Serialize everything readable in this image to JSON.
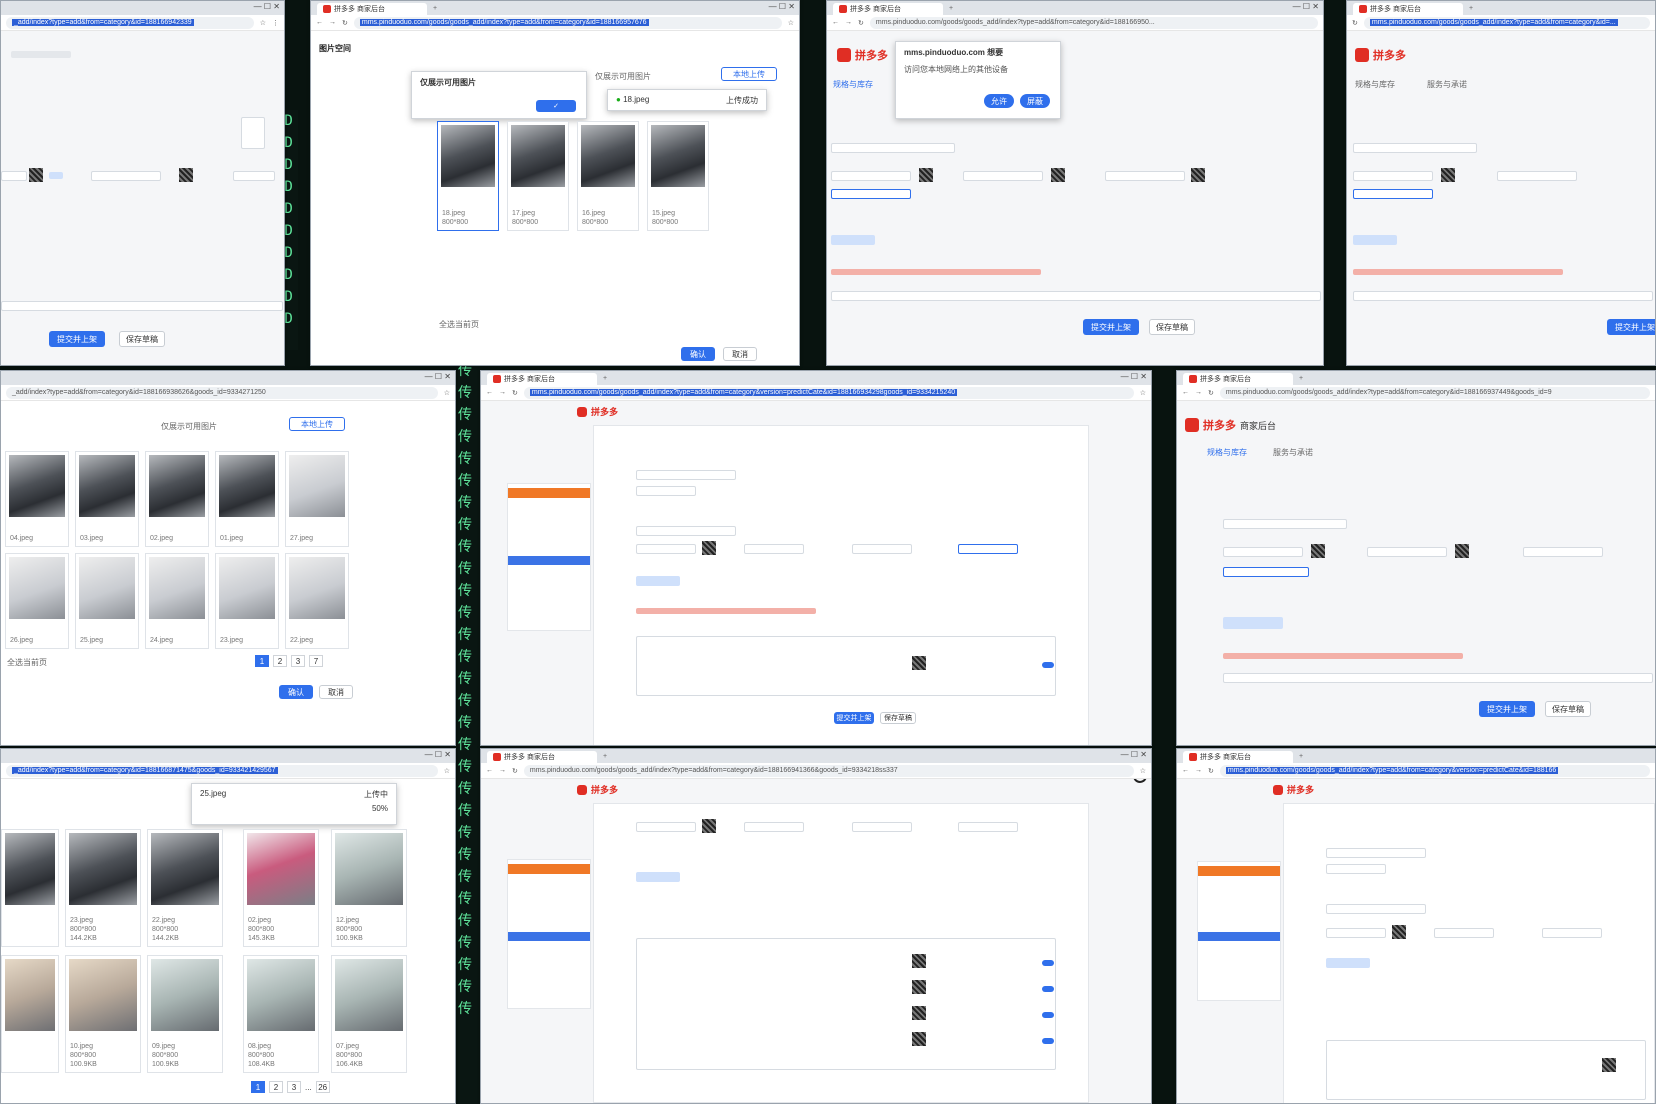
{
  "site": {
    "tab_title": "拼多多 商家后台",
    "domain": "mms.pinduoduo.com",
    "logo_text": "拼多多",
    "logo_sub": "商家后台"
  },
  "urls": {
    "w1": "_add/index?type=add&from=category&id=188166942339",
    "w2": "mms.pinduoduo.com/goods/goods_add/index?type=add&from=category&id=188166957676",
    "w3": "mms.pinduoduo.com/goods/goods_add/index?type=add&from=category&id=188166950...",
    "w4": "mms.pinduoduo.com/goods/goods_add/index?type=add&from=category&id=...",
    "w5": "_add/index?type=add&from=category&id=188166938626&goods_id=9334271250",
    "w6": "mms.pinduoduo.com/goods/goods_add/index?type=add&from=category&version=predictCate&id=188166934298goods_id=9334215240",
    "w7": "mms.pinduoduo.com/goods/goods_add/index?type=add&from=category&id=188166937449&goods_id=9",
    "w8": "_add/index?type=add&from=category&id=188166871475&goods_id=933421429567",
    "w9": "mms.pinduoduo.com/goods/goods_add/index?type=add&from=category&id=188166941366&goods_id=9334218ss337",
    "w10": "mms.pinduoduo.com/goods/goods_add/index?type=add&from=category&version=predictCate&id=188166"
  },
  "buttons": {
    "submit": "提交并上架",
    "save_draft": "保存草稿",
    "confirm": "确认",
    "cancel": "取消",
    "local_upload": "本地上传",
    "allow": "允许",
    "block": "屏蔽"
  },
  "nav": {
    "spec_stock": "规格与库存",
    "service": "服务与承诺"
  },
  "image_space": {
    "title": "图片空间",
    "only_usable": "仅展示可用图片",
    "tip_title": "仅展示可用图片",
    "select_all": "全选当前页",
    "uploading": "上传中",
    "upload_done": "上传成功"
  },
  "permission": {
    "site": "mms.pinduoduo.com 想要",
    "request": "访问您本地网络上的其他设备"
  },
  "thumbs_w2": [
    {
      "name": "18.jpeg",
      "size": "800*800"
    },
    {
      "name": "17.jpeg",
      "size": "800*800"
    },
    {
      "name": "16.jpeg",
      "size": "800*800"
    },
    {
      "name": "15.jpeg",
      "size": "800*800"
    }
  ],
  "thumbs_w5": [
    {
      "name": "04.jpeg"
    },
    {
      "name": "03.jpeg"
    },
    {
      "name": "02.jpeg"
    },
    {
      "name": "01.jpeg"
    },
    {
      "name": "27.jpeg"
    },
    {
      "name": "26.jpeg"
    },
    {
      "name": "25.jpeg"
    },
    {
      "name": "24.jpeg"
    },
    {
      "name": "23.jpeg"
    },
    {
      "name": "22.jpeg"
    }
  ],
  "thumbs_w8": [
    {
      "name": "23.jpeg",
      "dim": "800*800",
      "size": "144.2KB"
    },
    {
      "name": "22.jpeg",
      "dim": "800*800",
      "size": "144.2KB"
    },
    {
      "name": "02.jpeg",
      "dim": "800*800",
      "size": "145.3KB"
    },
    {
      "name": "12.jpeg",
      "dim": "800*800",
      "size": "100.9KB"
    },
    {
      "name": "10.jpeg",
      "dim": "800*800",
      "size": "100.9KB"
    },
    {
      "name": "09.jpeg",
      "dim": "800*800",
      "size": "100.9KB"
    },
    {
      "name": "08.jpeg",
      "dim": "800*800",
      "size": "108.4KB"
    },
    {
      "name": "07.jpeg",
      "dim": "800*800",
      "size": "106.4KB"
    }
  ],
  "upload_popup": {
    "file": "25.jpeg",
    "status": "上传中",
    "percent": "50%"
  },
  "pager_w5": [
    "1",
    "2",
    "3",
    "7"
  ],
  "pager_w8": [
    "1",
    "2",
    "3",
    "...",
    "26"
  ],
  "terminal_chars": "[D",
  "terminal_side_char": "传"
}
